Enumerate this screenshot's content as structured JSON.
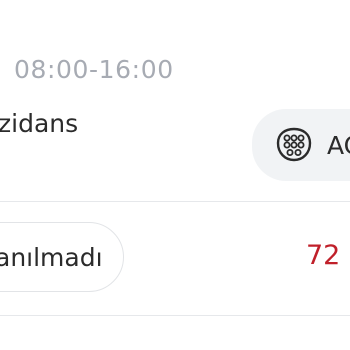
{
  "station": {
    "hours": "08:00-16:00",
    "name": "zidans"
  },
  "connector": {
    "icon": "ev-plug-icon",
    "label": "AC"
  },
  "status": {
    "label": "anılmadı",
    "count": "72",
    "count_color": "#c0202a"
  }
}
